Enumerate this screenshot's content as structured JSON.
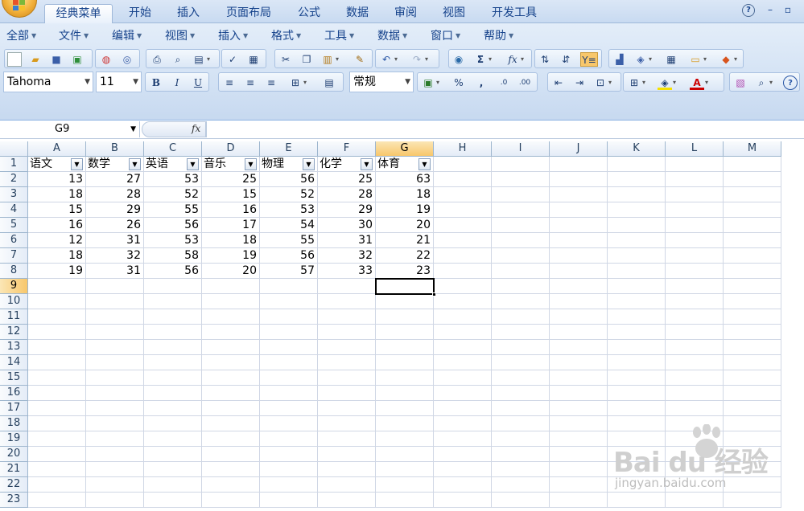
{
  "app": {
    "office_button": "office-button"
  },
  "tabs": [
    "经典菜单",
    "开始",
    "插入",
    "页面布局",
    "公式",
    "数据",
    "审阅",
    "视图",
    "开发工具"
  ],
  "window_controls": {
    "help": "?",
    "minimize": "–",
    "restore": "▫"
  },
  "menus": [
    "全部",
    "文件",
    "编辑",
    "视图",
    "插入",
    "格式",
    "工具",
    "数据",
    "窗口",
    "帮助"
  ],
  "toolbar": {
    "font_name": "Tahoma",
    "font_size": "11",
    "bold": "B",
    "italic": "I",
    "underline": "U",
    "number_format": "常规",
    "percent": "%",
    "comma": ",",
    "sum": "Σ",
    "function": "fx"
  },
  "formula_bar": {
    "name_box": "G9",
    "fx_label": "fx",
    "formula": ""
  },
  "columns": [
    "A",
    "B",
    "C",
    "D",
    "E",
    "F",
    "G",
    "H",
    "I",
    "J",
    "K",
    "L",
    "M"
  ],
  "rows": [
    "1",
    "2",
    "3",
    "4",
    "5",
    "6",
    "7",
    "8",
    "9",
    "10",
    "11",
    "12",
    "13",
    "14",
    "15",
    "16",
    "17",
    "18",
    "19",
    "20",
    "21",
    "22",
    "23"
  ],
  "sheet": {
    "headers": [
      "语文",
      "数学",
      "英语",
      "音乐",
      "物理",
      "化学",
      "体育"
    ],
    "data": [
      [
        "13",
        "27",
        "53",
        "25",
        "56",
        "25",
        "63"
      ],
      [
        "18",
        "28",
        "52",
        "15",
        "52",
        "28",
        "18"
      ],
      [
        "15",
        "29",
        "55",
        "16",
        "53",
        "29",
        "19"
      ],
      [
        "16",
        "26",
        "56",
        "17",
        "54",
        "30",
        "20"
      ],
      [
        "12",
        "31",
        "53",
        "18",
        "55",
        "31",
        "21"
      ],
      [
        "18",
        "32",
        "58",
        "19",
        "56",
        "32",
        "22"
      ],
      [
        "19",
        "31",
        "56",
        "20",
        "57",
        "33",
        "23"
      ]
    ],
    "active_column": "G",
    "active_row": "9"
  },
  "watermark": {
    "brand": "Bai du 经验",
    "url": "jingyan.baidu.com"
  },
  "colors": {
    "ribbon": "#d3e2f4",
    "accent": "#15428b",
    "selected_header": "#f8c76b"
  }
}
